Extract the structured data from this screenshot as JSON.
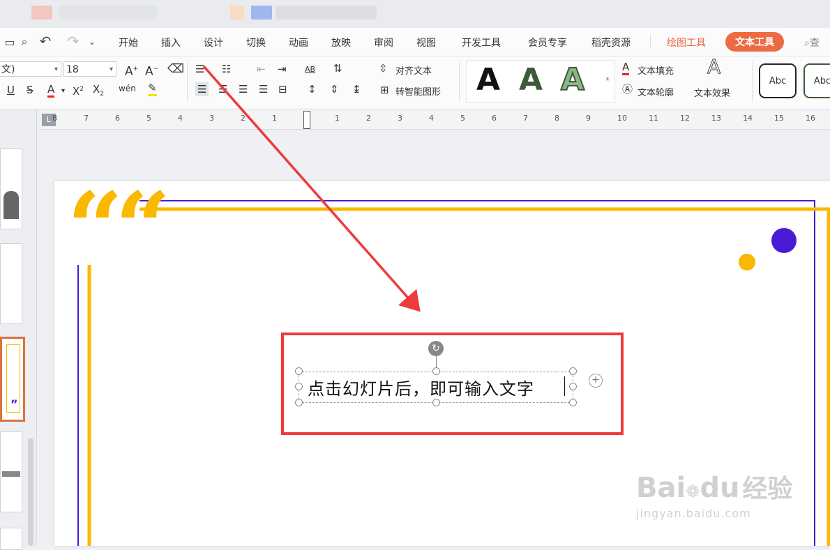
{
  "menu": {
    "tabs": [
      "开始",
      "插入",
      "设计",
      "切换",
      "动画",
      "放映",
      "审阅",
      "视图",
      "开发工具",
      "会员专享",
      "稻壳资源"
    ],
    "drawing_tools": "绘图工具",
    "text_tools": "文本工具",
    "search_partial": "查"
  },
  "ribbon": {
    "font_name": "文)",
    "font_size": "18",
    "align_text": "对齐文本",
    "smart_art": "转智能图形",
    "text_fill": "文本填充",
    "text_outline": "文本轮廓",
    "text_effect": "文本效果",
    "style_A": "A",
    "abc1": "Abc",
    "abc2": "Abc",
    "ab_icon": "AB",
    "wen_icon": "wén"
  },
  "ruler": {
    "left_ticks": [
      "8",
      "7",
      "6",
      "5",
      "4",
      "3",
      "2",
      "1"
    ],
    "right_ticks": [
      "1",
      "2",
      "3",
      "4",
      "5",
      "6",
      "7",
      "8",
      "9",
      "10",
      "11",
      "12",
      "13",
      "14",
      "15",
      "16"
    ]
  },
  "slide": {
    "textbox_text": "点击幻灯片后，即可输入文字",
    "quote_glyph": "““"
  },
  "watermark": {
    "brand": "Bai",
    "brand2": "du",
    "cn": "经验",
    "url": "jingyan.baidu.com"
  },
  "colors": {
    "accent": "#ee6a42",
    "gold": "#fbb800",
    "purple": "#4b1ad6",
    "red": "#ee3b3b"
  }
}
